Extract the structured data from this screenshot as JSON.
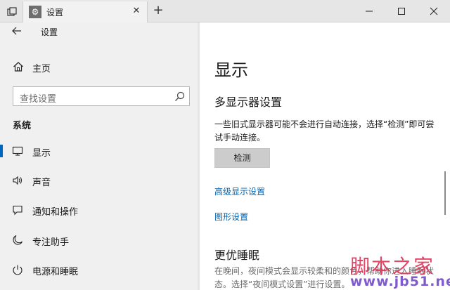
{
  "titlebar": {
    "tab_title": "设置",
    "tab_icon_glyph": "⚙",
    "icons": {
      "task_view": "task-view-icon",
      "tab_settings": "gear-icon",
      "tab_close": "close-icon",
      "new_tab": "plus-icon",
      "minimize": "minimize-icon",
      "maximize": "maximize-icon",
      "close": "close-icon"
    },
    "glyphs": {
      "close": "✕",
      "new_tab": "+"
    }
  },
  "sidebar": {
    "back_label": "设置",
    "home_label": "主页",
    "search_placeholder": "查找设置",
    "section_title": "系统",
    "items": [
      {
        "label": "显示",
        "icon": "monitor-icon",
        "active": true
      },
      {
        "label": "声音",
        "icon": "speaker-icon",
        "active": false
      },
      {
        "label": "通知和操作",
        "icon": "notification-icon",
        "active": false
      },
      {
        "label": "专注助手",
        "icon": "moon-icon",
        "active": false
      },
      {
        "label": "电源和睡眠",
        "icon": "power-icon",
        "active": false
      }
    ]
  },
  "main": {
    "title": "显示",
    "multi_display_heading": "多显示器设置",
    "multi_display_desc": "一些旧式显示器可能不会进行自动连接，选择“检测”即可尝试手动连接。",
    "detect_button": "检测",
    "advanced_link": "高级显示设置",
    "graphics_link": "图形设置",
    "sleep_heading": "更优睡眠",
    "sleep_desc": "在晚间，夜间模式会显示较柔和的颜色，帮助你进入睡眠状态。选择“夜间模式设置”进行设置。"
  },
  "watermark": {
    "line1": "脚本之家",
    "line2": "www.jb51.net"
  },
  "colors": {
    "accent": "#0067c0",
    "link": "#0063b1",
    "sidebar_bg": "#f0f0f0",
    "titlebar_bg": "#e6e6e6"
  }
}
